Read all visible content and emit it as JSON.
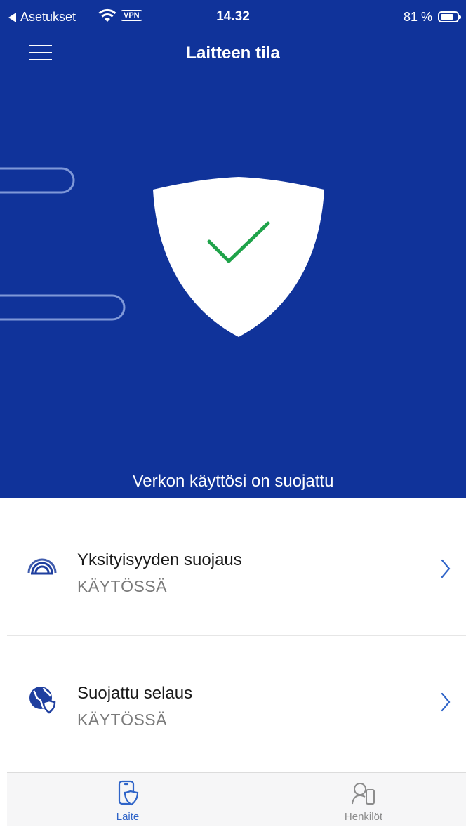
{
  "status_bar": {
    "back_label": "Asetukset",
    "vpn_badge": "VPN",
    "time": "14.32",
    "battery_percent": "81 %",
    "battery_level": 0.81
  },
  "header": {
    "title": "Laitteen tila",
    "menu_icon": "hamburger-icon"
  },
  "hero": {
    "status_icon": "shield-check-icon",
    "caption": "Verkon käyttösi on suojattu"
  },
  "list": [
    {
      "icon": "privacy-signal-icon",
      "title": "Yksityisyyden suojaus",
      "status": "KÄYTÖSSÄ"
    },
    {
      "icon": "globe-shield-icon",
      "title": "Suojattu selaus",
      "status": "KÄYTÖSSÄ"
    }
  ],
  "tabs": [
    {
      "icon": "device-shield-icon",
      "label": "Laite",
      "active": true
    },
    {
      "icon": "people-device-icon",
      "label": "Henkilöt",
      "active": false
    }
  ],
  "colors": {
    "hero_background": "#10339a",
    "check_green": "#1fa34a",
    "active_tab": "#2f64c8",
    "status_gray": "#7a7a7a"
  }
}
